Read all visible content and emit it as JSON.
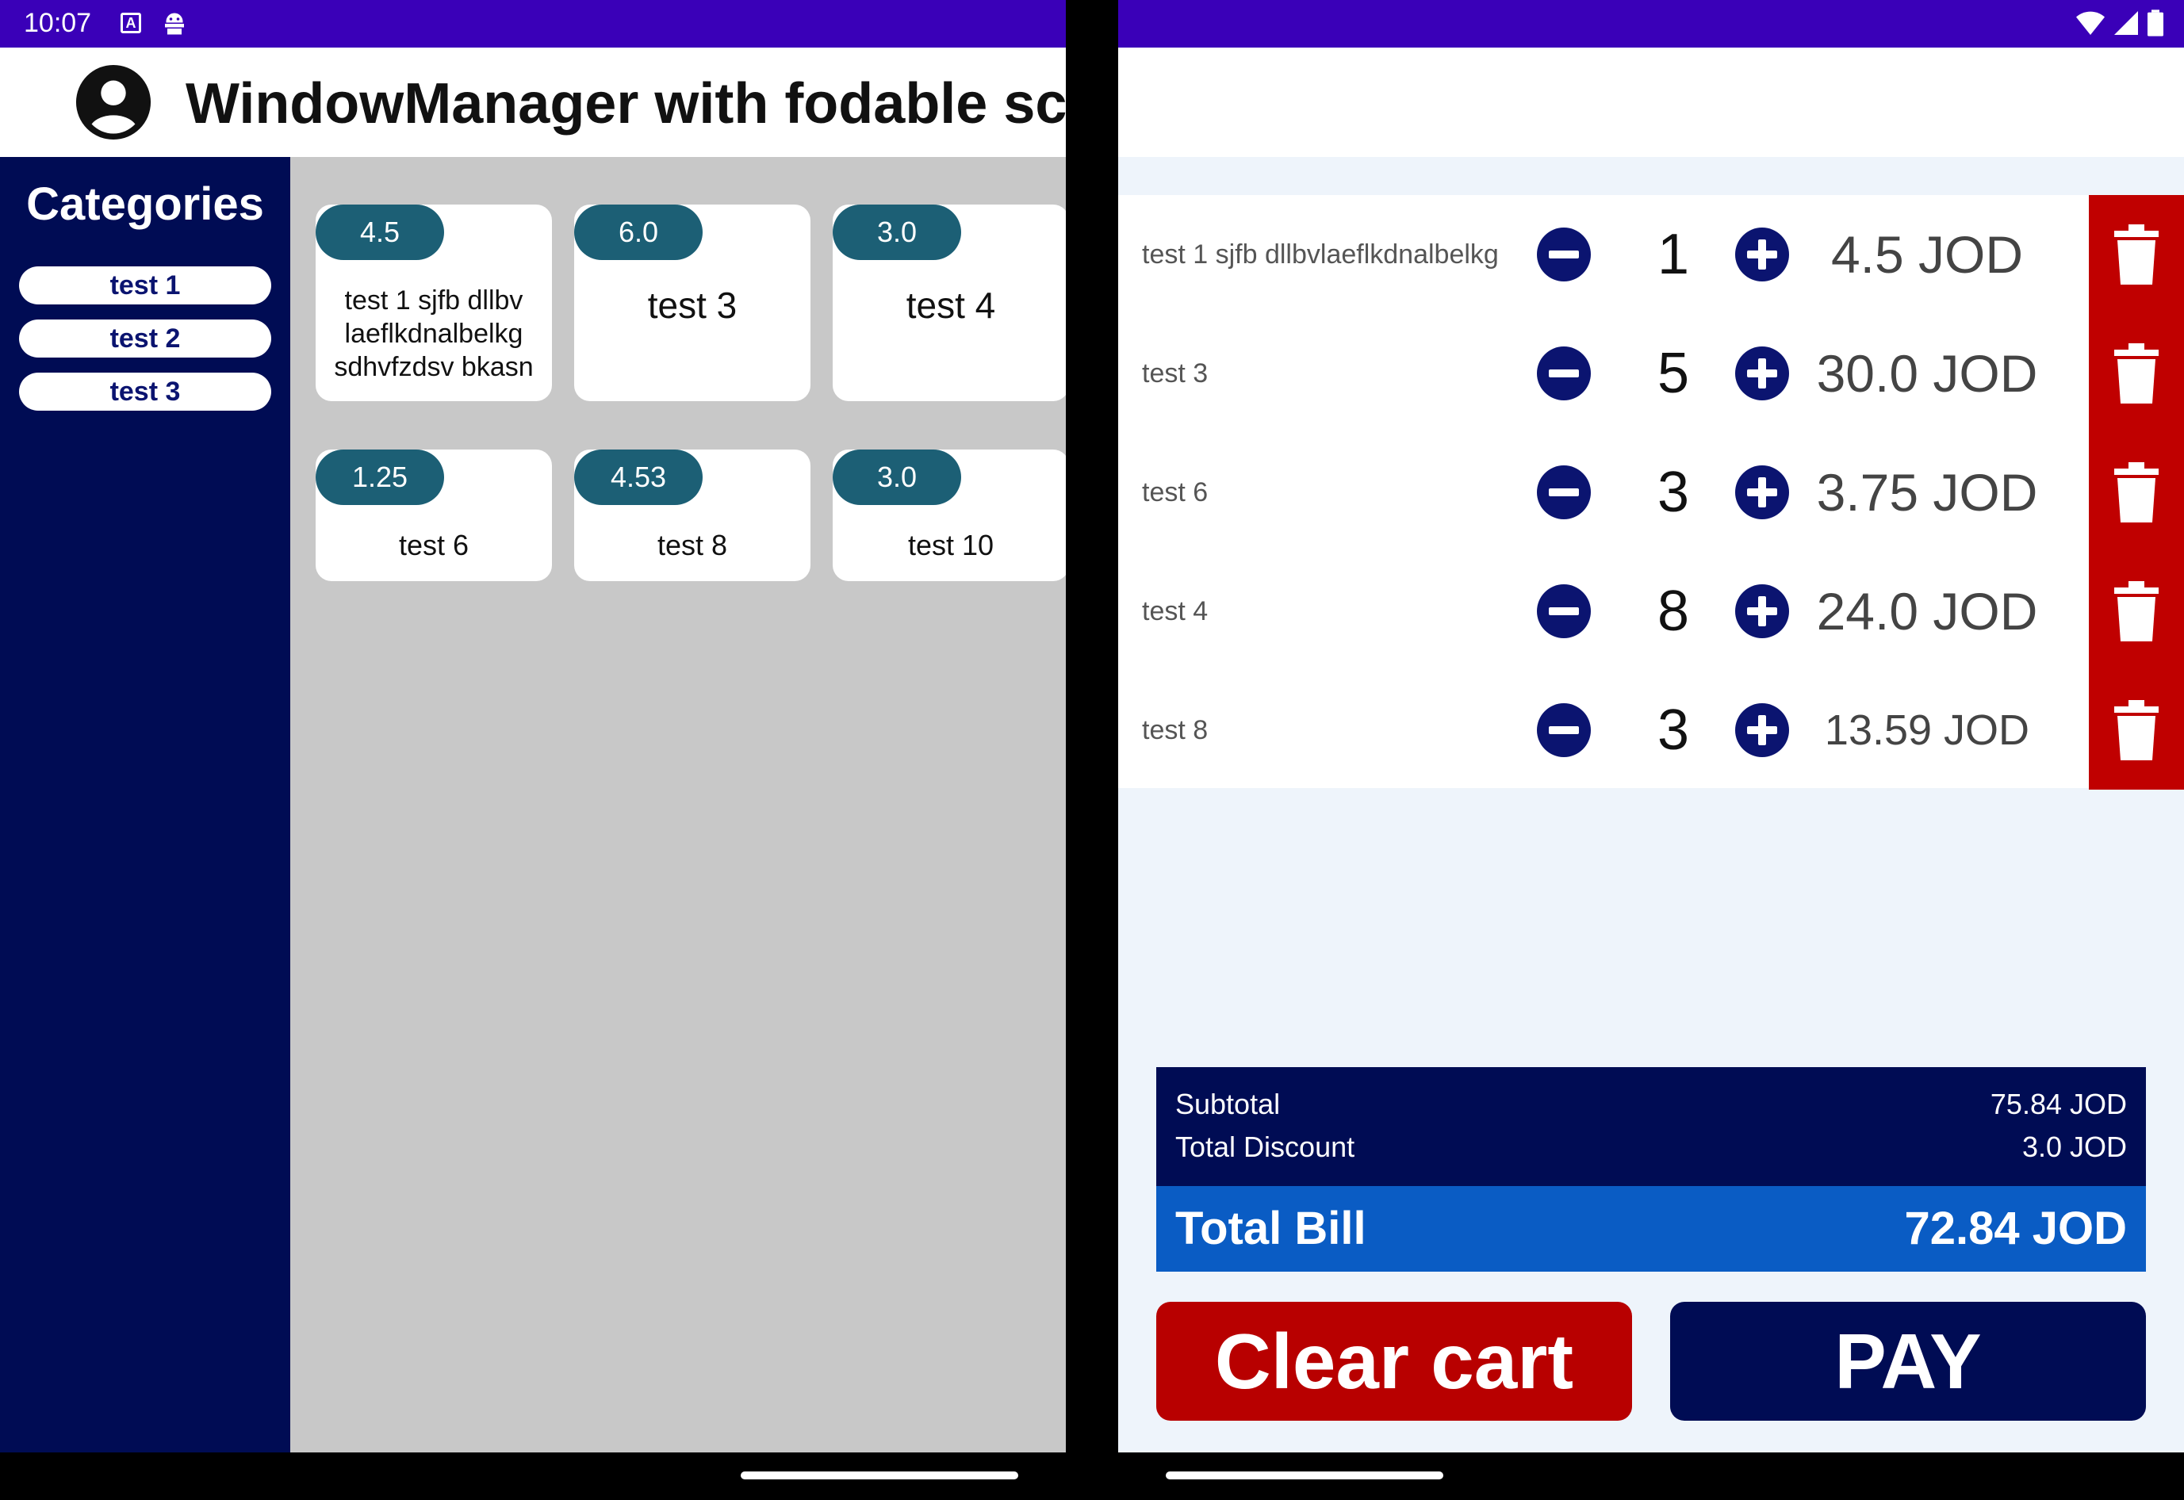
{
  "status_bar": {
    "time": "10:07",
    "notif_icon_1": "A",
    "notif_icon_2": "android-debug-icon",
    "right_icons": [
      "wifi-icon",
      "signal-icon",
      "battery-icon"
    ]
  },
  "app_bar": {
    "title": "WindowManager with fodable screen",
    "avatar_icon": "account-circle-icon"
  },
  "categories": {
    "title": "Categories",
    "items": [
      {
        "label": "test 1"
      },
      {
        "label": "test 2"
      },
      {
        "label": "test 3"
      }
    ]
  },
  "products": [
    {
      "price": "4.5",
      "name": "test 1 sjfb dllbv laeflkdnalbelkg sdhvfzdsv bkasn"
    },
    {
      "price": "6.0",
      "name": "test 3"
    },
    {
      "price": "3.0",
      "name": "test 4"
    },
    {
      "price": "1.25",
      "name": "test 6"
    },
    {
      "price": "4.53",
      "name": "test 8"
    },
    {
      "price": "3.0",
      "name": "test 10"
    }
  ],
  "cart": {
    "items": [
      {
        "name": "test 1 sjfb dllbvlaeflkdnalbelkg",
        "qty": "1",
        "price": "4.5 JOD"
      },
      {
        "name": "test 3",
        "qty": "5",
        "price": "30.0 JOD"
      },
      {
        "name": "test 6",
        "qty": "3",
        "price": "3.75 JOD"
      },
      {
        "name": "test 4",
        "qty": "8",
        "price": "24.0 JOD"
      },
      {
        "name": "test 8",
        "qty": "3",
        "price": "13.59 JOD"
      }
    ]
  },
  "summary": {
    "subtotal_label": "Subtotal",
    "subtotal_value": "75.84 JOD",
    "discount_label": "Total Discount",
    "discount_value": "3.0 JOD",
    "total_label": "Total Bill",
    "total_value": "72.84 JOD"
  },
  "actions": {
    "clear_label": "Clear cart",
    "pay_label": "PAY"
  },
  "colors": {
    "status_bar": "#3a00b8",
    "navy": "#000c54",
    "teal_badge": "#1c5f75",
    "delete_red": "#c00000",
    "total_blue": "#0a5cc4"
  }
}
